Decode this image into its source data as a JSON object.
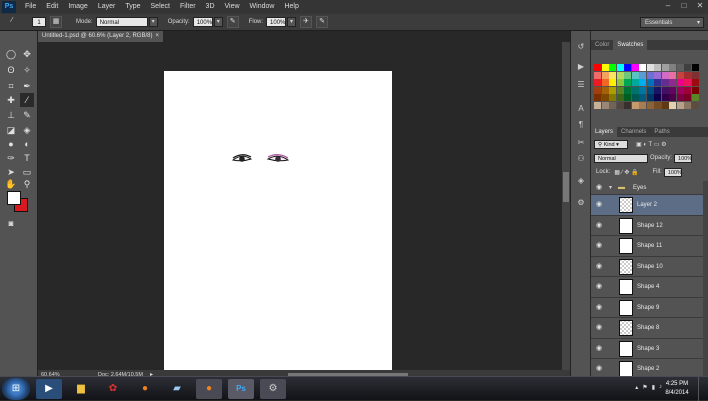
{
  "app": {
    "logo": "Ps"
  },
  "menu": [
    "File",
    "Edit",
    "Image",
    "Layer",
    "Type",
    "Select",
    "Filter",
    "3D",
    "View",
    "Window",
    "Help"
  ],
  "window_controls": [
    "–",
    "□",
    "✕"
  ],
  "options": {
    "mode_label": "Mode:",
    "mode_value": "Normal",
    "opacity_label": "Opacity:",
    "opacity_value": "100%",
    "flow_label": "Flow:",
    "flow_value": "100%",
    "workspace": "Essentials",
    "brush_size": "1"
  },
  "document": {
    "tab_title": "Untitled-1.psd @ 60.6% (Layer 2, RGB/8)",
    "zoom": "60.64%",
    "doc_size": "Doc: 2.64M/10.5M"
  },
  "colors": {
    "foreground": "#ffffff",
    "background": "#d8191f",
    "accent": "#5d6d85"
  },
  "swatches_panel": {
    "tabs": [
      "Color",
      "Swatches"
    ],
    "active_tab": "Swatches"
  },
  "layers_panel": {
    "tabs": [
      "Layers",
      "Channels",
      "Paths"
    ],
    "active_tab": "Layers",
    "kind_label": "Kind",
    "blend_mode": "Normal",
    "opacity_label": "Opacity:",
    "opacity_value": "100%",
    "lock_label": "Lock:",
    "fill_label": "Fill:",
    "fill_value": "100%",
    "group": "Eyes",
    "layers": [
      "Layer 2",
      "Shape 12",
      "Shape 11",
      "Shape 10",
      "Shape 4",
      "Shape 9",
      "Shape 8",
      "Shape 3",
      "Shape 2"
    ],
    "selected": "Layer 2"
  },
  "taskbar": {
    "time": "4:25 PM",
    "date": "8/4/2014"
  }
}
